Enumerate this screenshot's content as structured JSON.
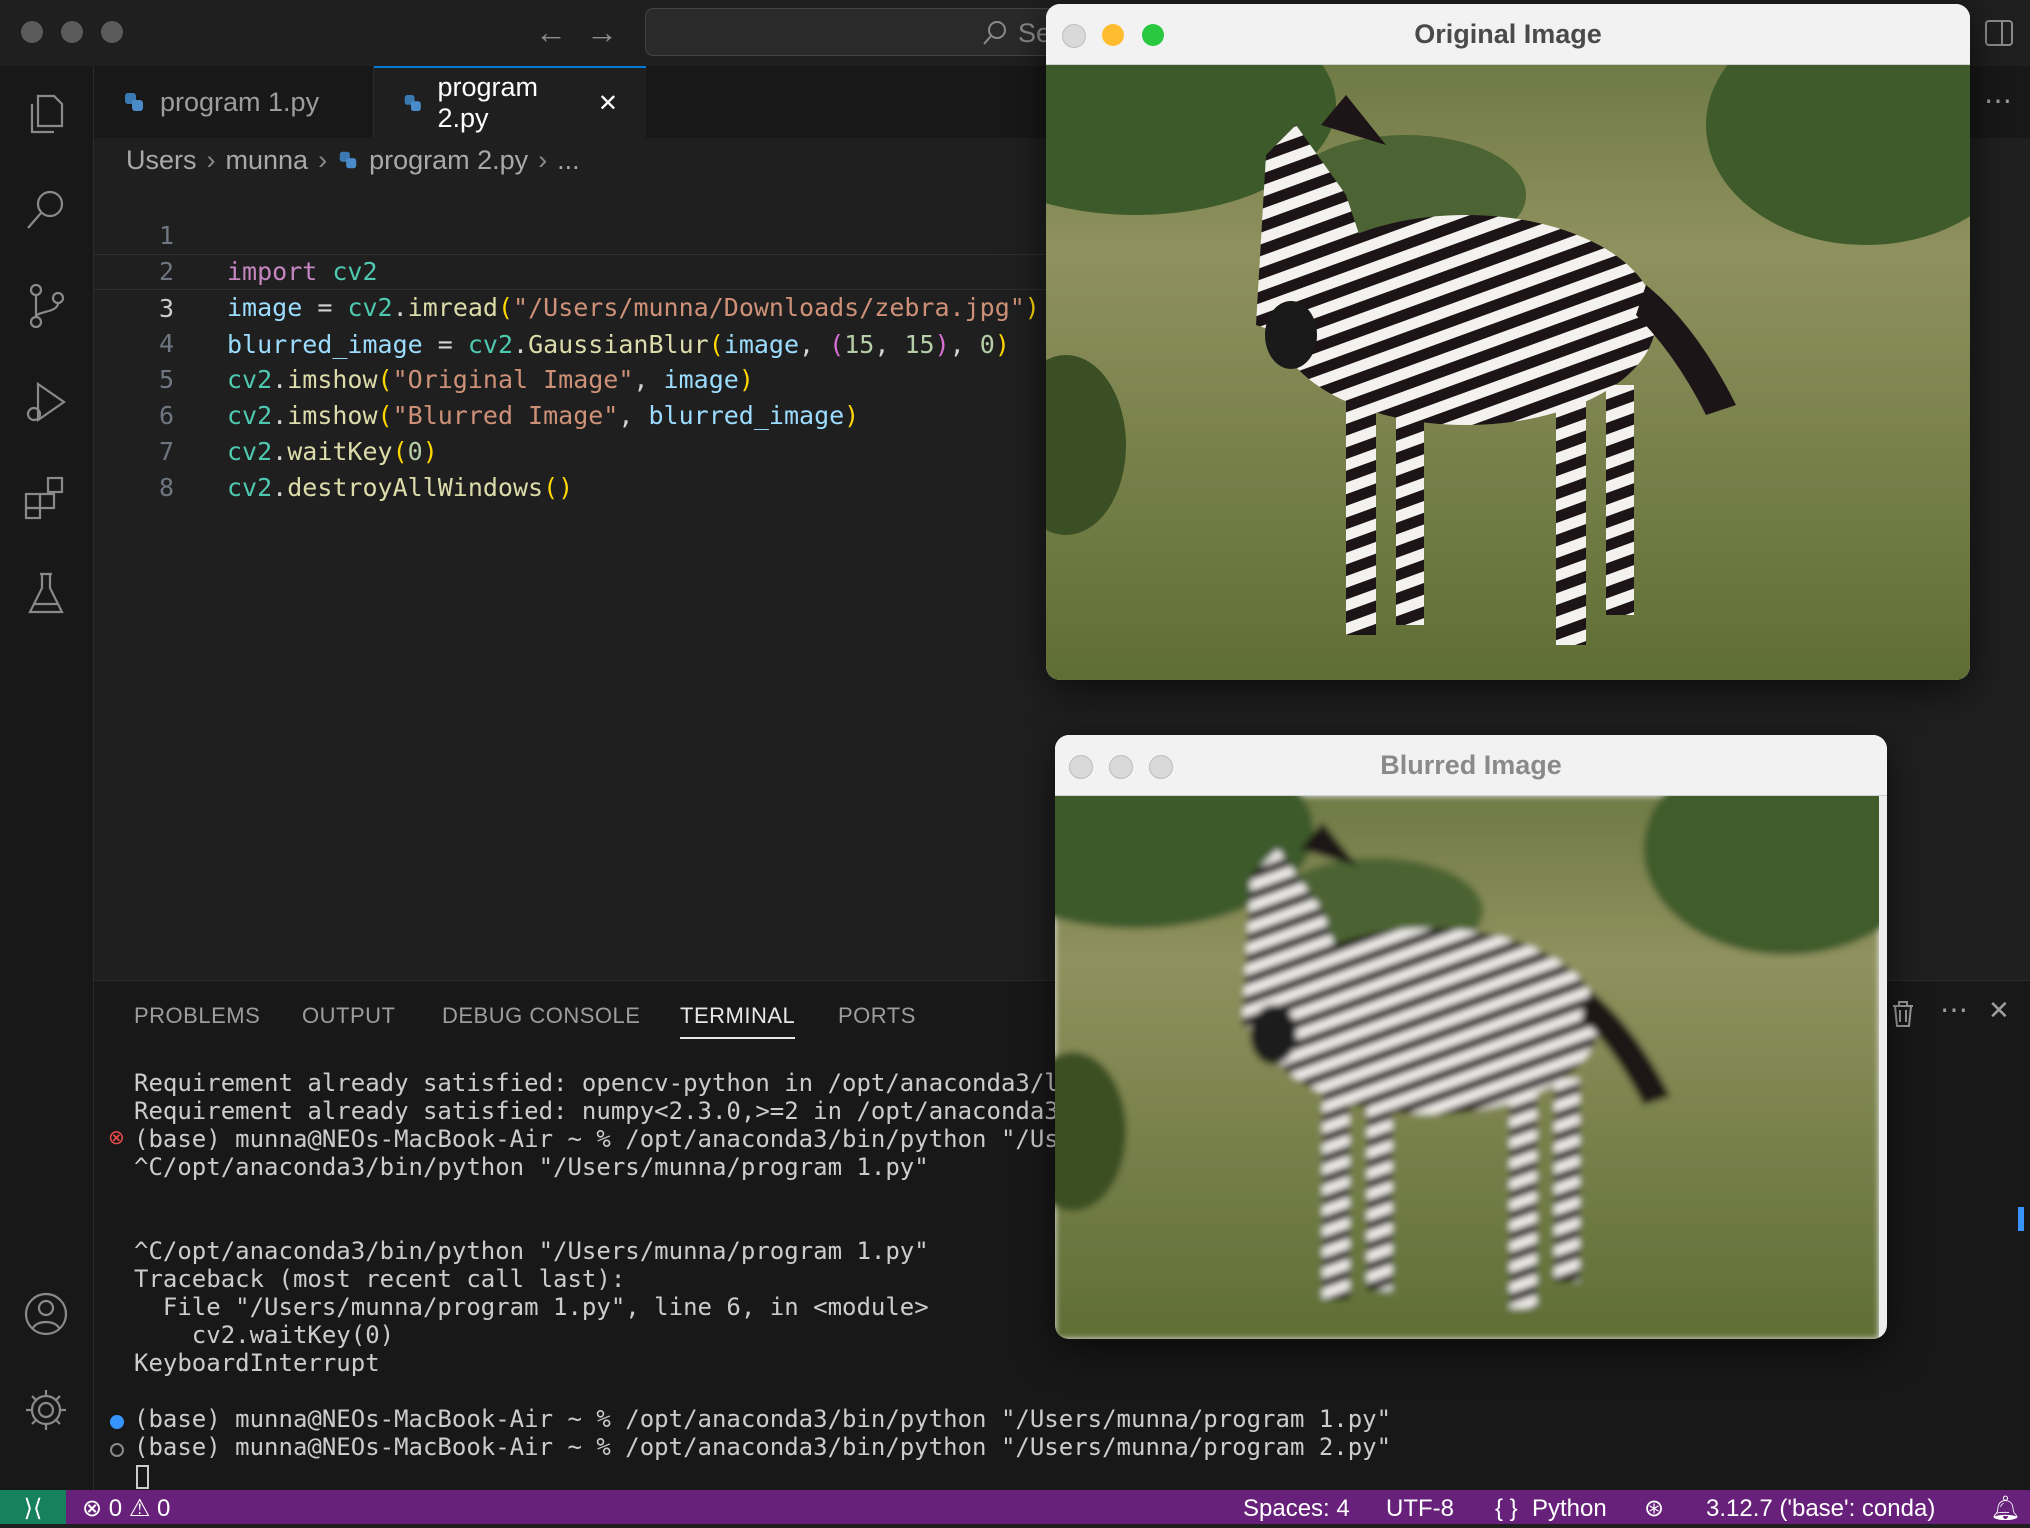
{
  "search": {
    "placeholder": "Se"
  },
  "tabs": [
    {
      "label": "program 1.py"
    },
    {
      "label": "program 2.py",
      "close": "✕"
    }
  ],
  "breadcrumb": {
    "parts": [
      "Users",
      "munna",
      "program 2.py",
      "..."
    ]
  },
  "editor": {
    "line_numbers": [
      "1",
      "2",
      "3",
      "4",
      "5",
      "6",
      "7",
      "8"
    ],
    "active_line": "3"
  },
  "panel": {
    "tabs": [
      "PROBLEMS",
      "OUTPUT",
      "DEBUG CONSOLE",
      "TERMINAL",
      "PORTS"
    ],
    "active_tab": "TERMINAL",
    "terminal_lines": [
      "Requirement already satisfied: opencv-python in /opt/anaconda3/lib",
      "Requirement already satisfied: numpy<2.3.0,>=2 in /opt/anaconda3/l",
      "(base) munna@NEOs-MacBook-Air ~ % /opt/anaconda3/bin/python \"/User",
      "^C/opt/anaconda3/bin/python \"/Users/munna/program 1.py\"",
      "",
      "",
      "^C/opt/anaconda3/bin/python \"/Users/munna/program 1.py\"",
      "Traceback (most recent call last):",
      "  File \"/Users/munna/program 1.py\", line 6, in <module>",
      "    cv2.waitKey(0)",
      "KeyboardInterrupt",
      "",
      "(base) munna@NEOs-MacBook-Air ~ % /opt/anaconda3/bin/python \"/Users/munna/program 1.py\"",
      "(base) munna@NEOs-MacBook-Air ~ % /opt/anaconda3/bin/python \"/Users/munna/program 2.py\""
    ]
  },
  "statusbar": {
    "errors": "0",
    "warnings": "0",
    "spaces": "Spaces: 4",
    "encoding": "UTF-8",
    "language": "Python",
    "interpreter": "3.12.7 ('base': conda)"
  },
  "windows": {
    "original": {
      "title": "Original Image"
    },
    "blurred": {
      "title": "Blurred Image"
    }
  },
  "colors": {
    "accent": "#0078d4",
    "statusbar": "#68217a"
  }
}
